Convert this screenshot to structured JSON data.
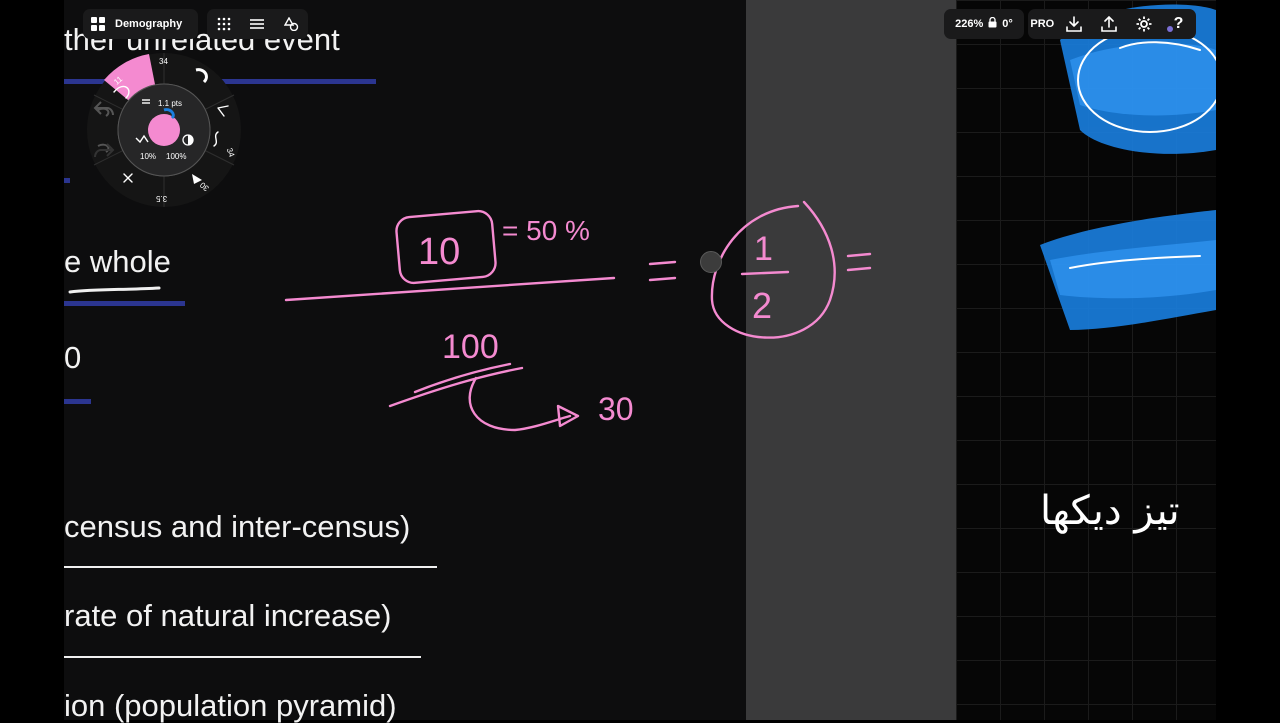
{
  "canvas": {
    "notes": {
      "line1": "ther unrelated event",
      "line2": "e whole",
      "line3": "0",
      "line4": "census and inter-census)",
      "line5": "rate of natural increase)",
      "line6": "ion (population pyramid)"
    },
    "ink": {
      "boxed_number": "10",
      "percent": "= 50 %",
      "denominator": "100",
      "side_value": "30",
      "fraction_numerator": "1",
      "fraction_denominator": "2",
      "equals": "="
    },
    "grid_script": "تیز دیکها"
  },
  "top_left_toolbar": {
    "document_title": "Demography",
    "gallery_icon": "grid-2x2-icon",
    "grid_dots_icon": "dots-grid-icon",
    "layers_icon": "layers-icon",
    "shapes_icon": "shapes-icon"
  },
  "top_right_toolbar": {
    "zoom": "226%",
    "rotation": "0°",
    "pro_label": "PRO",
    "accent": "#7b6fd6"
  },
  "brush_wheel": {
    "size_label": "1.1 pts",
    "opacity": "10%",
    "flow": "100%",
    "preset_top": "34",
    "preset_right": "34",
    "preset_bottom_right": "30",
    "preset_bottom": "3.5",
    "preset_top_left": "11",
    "color": "#f48ad0"
  },
  "colors": {
    "ink_pink": "#f48ad0",
    "rule_blue": "#2b3590",
    "highlight_blue": "#1a7fe0"
  }
}
